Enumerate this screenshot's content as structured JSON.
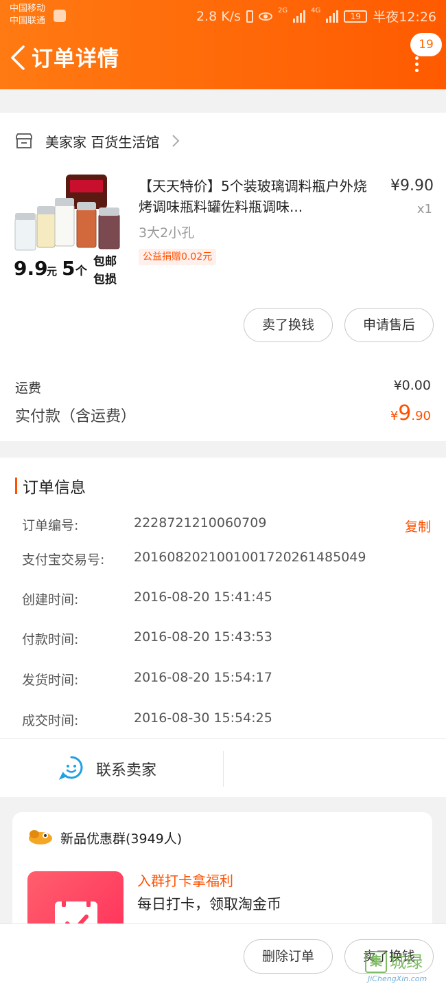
{
  "status_bar": {
    "carrier1": "中国移动",
    "carrier2": "中国联通",
    "speed": "2.8 K/s",
    "net1": "2G",
    "net2": "4G",
    "battery": "19",
    "time": "半夜12:26"
  },
  "header": {
    "title": "订单详情",
    "badge": "19"
  },
  "shop": {
    "name": "美家家 百货生活馆"
  },
  "product": {
    "title": "【天天特价】5个装玻璃调料瓶户外烧烤调味瓶料罐佐料瓶调味...",
    "sku": "3大2小孔",
    "tag": "公益捐赠0.02元",
    "price": "¥9.90",
    "qty": "x1",
    "image_text_price": "9.9",
    "image_text_unit": "元",
    "image_text_count": "5",
    "image_text_ge": "个",
    "image_text_line1": "包邮",
    "image_text_line2": "包损"
  },
  "actions": {
    "sell": "卖了换钱",
    "after_sale": "申请售后",
    "delete": "删除订单",
    "sell2": "卖了换钱"
  },
  "fees": {
    "shipping_label": "运费",
    "shipping_value": "¥0.00",
    "paid_label": "实付款（含运费）",
    "paid_currency": "¥",
    "paid_int": "9",
    "paid_dec": ".90"
  },
  "order_info": {
    "title": "订单信息",
    "copy": "复制",
    "rows": [
      {
        "label": "订单编号:",
        "value": "2228721210060709"
      },
      {
        "label": "支付宝交易号:",
        "value": "2016082021001001720261485049"
      },
      {
        "label": "创建时间:",
        "value": "2016-08-20 15:41:45"
      },
      {
        "label": "付款时间:",
        "value": "2016-08-20 15:43:53"
      },
      {
        "label": "发货时间:",
        "value": "2016-08-20 15:54:17"
      },
      {
        "label": "成交时间:",
        "value": "2016-08-30 15:54:25"
      }
    ],
    "contact": "联系卖家"
  },
  "group": {
    "name": "新品优惠群(3949人)",
    "promo": "入群打卡拿福利",
    "desc": "每日打卡，领取淘金币"
  },
  "watermark": {
    "cn": "城绿",
    "logo": "集",
    "en": "JiChengXin.com"
  },
  "colors": {
    "accent": "#ff5000",
    "header_start": "#ff7a12",
    "header_end": "#ff5a00"
  }
}
